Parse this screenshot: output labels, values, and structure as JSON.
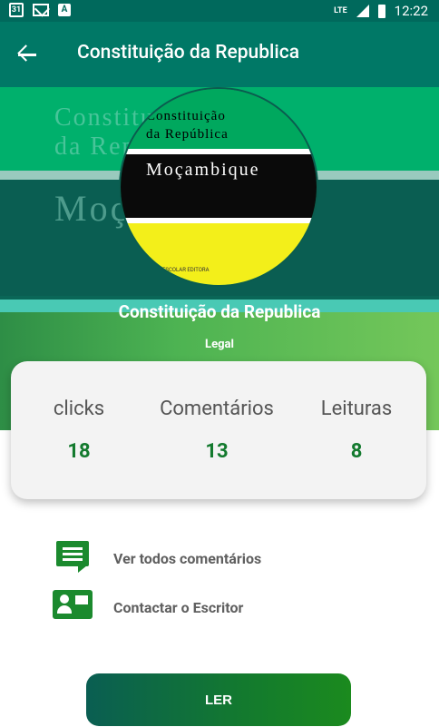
{
  "status_bar": {
    "date_icon": "31",
    "network": "LTE",
    "time": "12:22"
  },
  "appbar": {
    "title": "Constituição da Republica"
  },
  "banner": {
    "bg_line1": "Constituição",
    "bg_line2": "da República",
    "bg_line3": "Moçambique"
  },
  "cover": {
    "line1": "Constituição",
    "line2": "da República",
    "country": "Moçambique",
    "publisher": "ESCOLAR EDITORA"
  },
  "book": {
    "title": "Constituição da Republica",
    "category": "Legal"
  },
  "stats": [
    {
      "label": "clicks",
      "value": "18"
    },
    {
      "label": "Comentários",
      "value": "13"
    },
    {
      "label": "Leituras",
      "value": "8"
    }
  ],
  "actions": {
    "comments_label": "Ver todos comentários",
    "contact_label": "Contactar o Escritor"
  },
  "read_button": {
    "label": "LER"
  },
  "colors": {
    "primary": "#007866",
    "accent_green": "#137a2e",
    "cover_yellow": "#f3ef1a"
  }
}
